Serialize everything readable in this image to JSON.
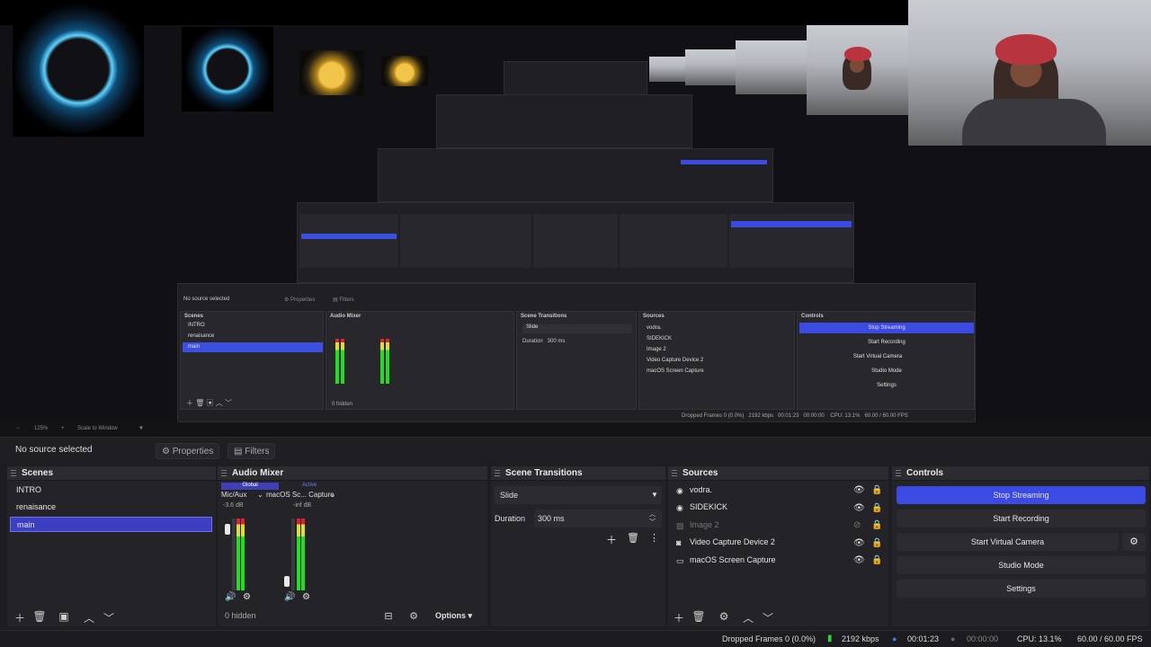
{
  "source_bar": {
    "status": "No source selected",
    "properties_label": "Properties",
    "filters_label": "Filters"
  },
  "zoom_bar": {
    "zoom": "125%",
    "scale_mode": "Scale to Window"
  },
  "scenes": {
    "title": "Scenes",
    "items": [
      "INTRO",
      "renaisance",
      "main"
    ],
    "selected": "main"
  },
  "audio_mixer": {
    "title": "Audio Mixer",
    "col1_header": "Global",
    "col2_header": "Active",
    "channel1_name": "Mic/Aux",
    "channel1_db": "-3.6 dB",
    "channel2_name": "macOS Sc... Capture",
    "channel2_db": "-inf dB",
    "hidden_count": "0 hidden",
    "options_label": "Options"
  },
  "scene_transitions": {
    "title": "Scene Transitions",
    "transition": "Slide",
    "duration_label": "Duration",
    "duration_value": "300 ms"
  },
  "sources": {
    "title": "Sources",
    "items": [
      "vodra.",
      "SIDEKICK",
      "Image 2",
      "Video Capture Device 2",
      "macOS Screen Capture"
    ]
  },
  "controls": {
    "title": "Controls",
    "stop_streaming": "Stop Streaming",
    "start_recording": "Start Recording",
    "start_virtual_camera": "Start Virtual Camera",
    "studio_mode": "Studio Mode",
    "settings": "Settings"
  },
  "status_bar": {
    "dropped_frames": "Dropped Frames 0 (0.0%)",
    "bitrate": "2192 kbps",
    "stream_time": "00:01:23",
    "record_time": "00:00:00",
    "cpu": "CPU: 13.1%",
    "fps": "60.00 / 60.00 FPS"
  },
  "colors": {
    "accent": "#3c4ae4",
    "scene_selected": "#3c3fc2",
    "panel_bg": "#232328"
  }
}
